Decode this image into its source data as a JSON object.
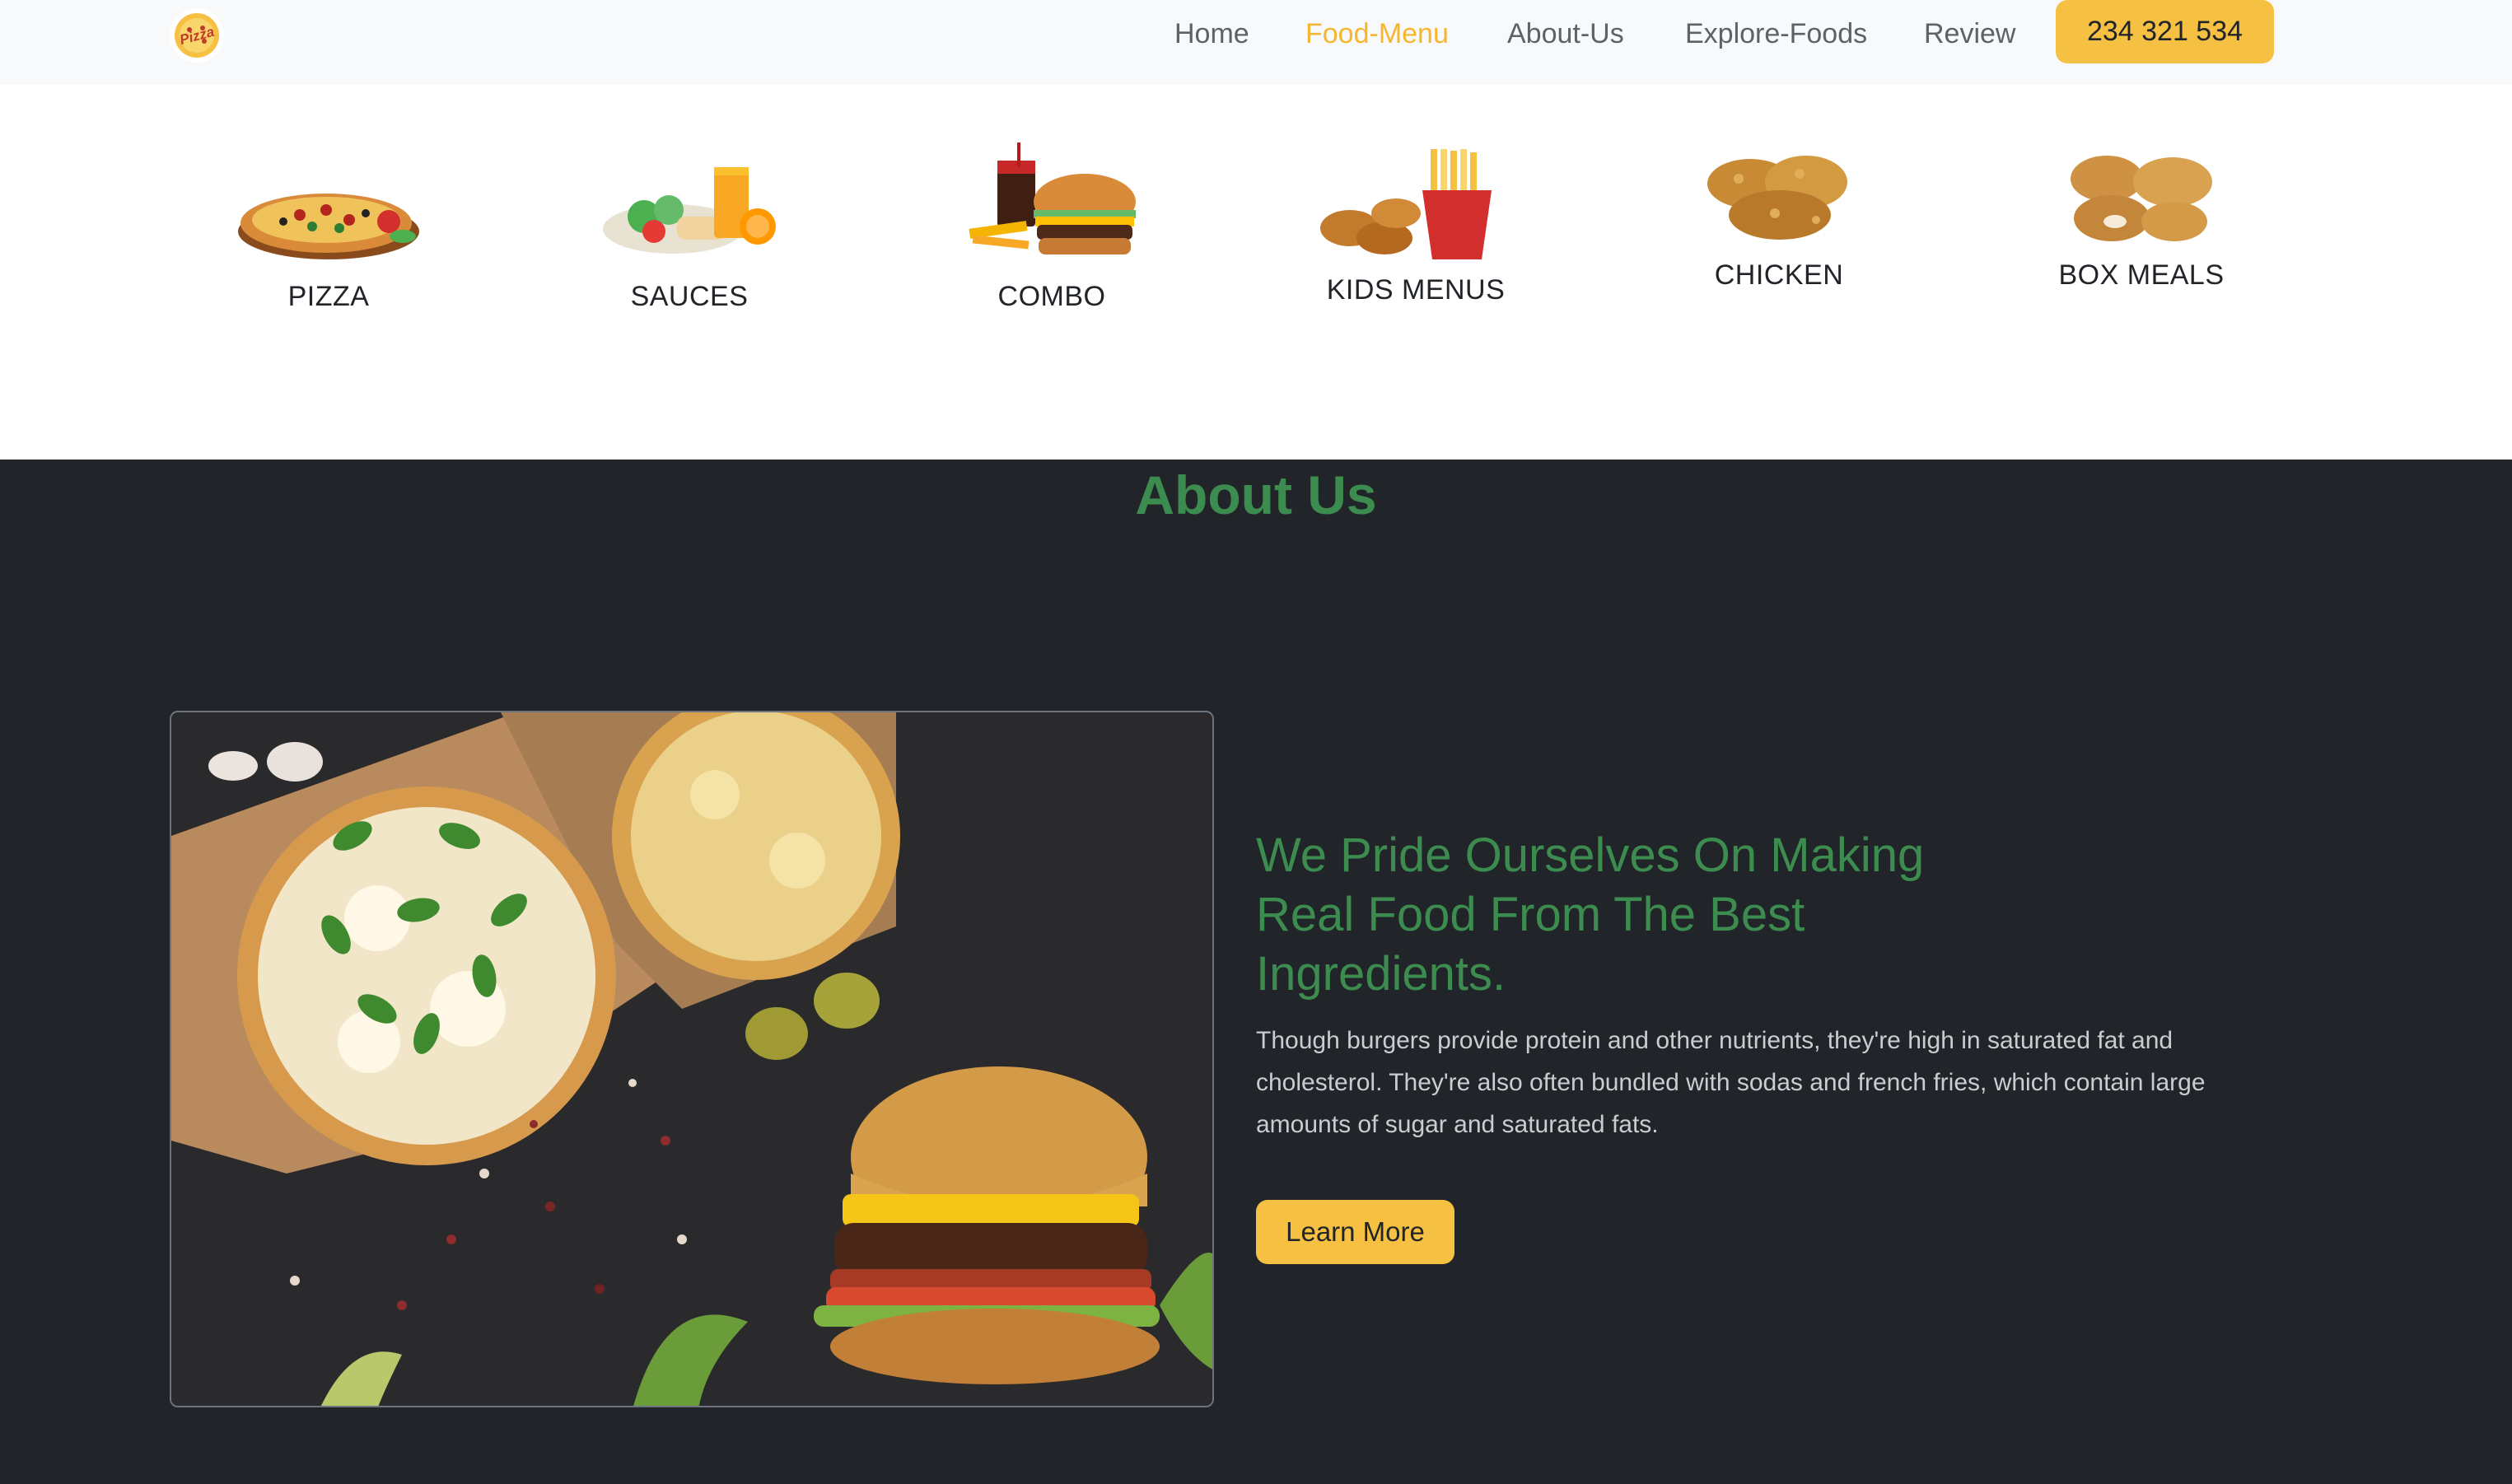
{
  "nav": {
    "logo_text": "Pizza",
    "links": [
      {
        "label": "Home",
        "active": false
      },
      {
        "label": "Food-Menu",
        "active": true
      },
      {
        "label": "About-Us",
        "active": false
      },
      {
        "label": "Explore-Foods",
        "active": false
      },
      {
        "label": "Review",
        "active": false
      }
    ],
    "phone": "234 321 534"
  },
  "categories": [
    {
      "label": "PIZZA",
      "icon": "pizza-image"
    },
    {
      "label": "SAUCES",
      "icon": "salad-juice-image"
    },
    {
      "label": "COMBO",
      "icon": "burger-combo-image"
    },
    {
      "label": "KIDS MENUS",
      "icon": "nuggets-fries-image"
    },
    {
      "label": "CHICKEN",
      "icon": "fried-chicken-image"
    },
    {
      "label": "BOX MEALS",
      "icon": "chicken-nuggets-image"
    }
  ],
  "about": {
    "title": "About Us",
    "heading": "We Pride Ourselves On Making Real Food From The Best Ingredients.",
    "body": "Though burgers provide protein and other nutrients, they're high in saturated fat and cholesterol. They're also often bundled with sodas and french fries, which contain large amounts of sugar and saturated fats.",
    "button": "Learn More",
    "image": "pizza-and-burger-photo"
  },
  "colors": {
    "accent_yellow": "#f6c143",
    "active_link": "#f5b630",
    "heading_green": "#3d8c4f",
    "dark_bg": "#212529",
    "nav_bg": "#f8f9fa"
  }
}
